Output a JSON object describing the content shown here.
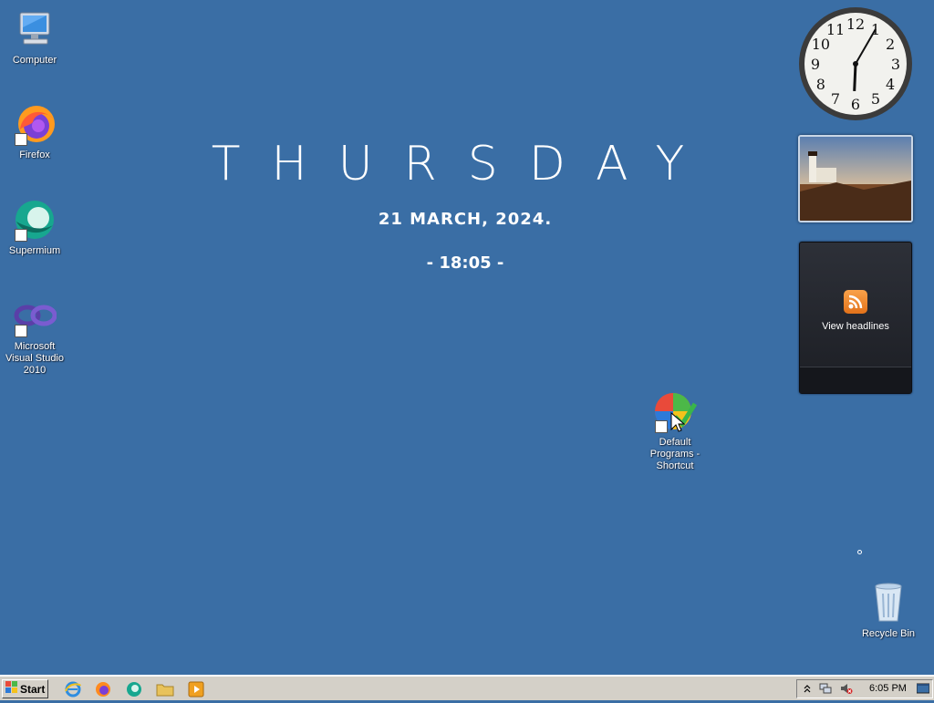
{
  "desktop": {
    "icons": [
      {
        "label": "Computer"
      },
      {
        "label": "Firefox"
      },
      {
        "label": "Supermium"
      },
      {
        "label": "Microsoft Visual Studio 2010"
      },
      {
        "label": "Default Programs - Shortcut"
      },
      {
        "label": "Recycle Bin"
      }
    ]
  },
  "widget": {
    "day": "THURSDAY",
    "date": "21 MARCH, 2024.",
    "time": "- 18:05 -"
  },
  "gadgets": {
    "clock": {
      "numerals": [
        "12",
        "1",
        "2",
        "3",
        "4",
        "5",
        "6",
        "7",
        "8",
        "9",
        "10",
        "11"
      ],
      "hour": 6,
      "minute": 5
    },
    "feed": {
      "label": "View headlines"
    }
  },
  "taskbar": {
    "start_label": "Start",
    "quick_launch": [
      "internet-explorer-icon",
      "firefox-icon",
      "supermium-icon",
      "folder-icon",
      "media-player-icon"
    ],
    "tray": {
      "time": "6:05 PM"
    }
  },
  "colors": {
    "desktop": "#3a6ea5",
    "taskbar": "#d4d0c8"
  }
}
